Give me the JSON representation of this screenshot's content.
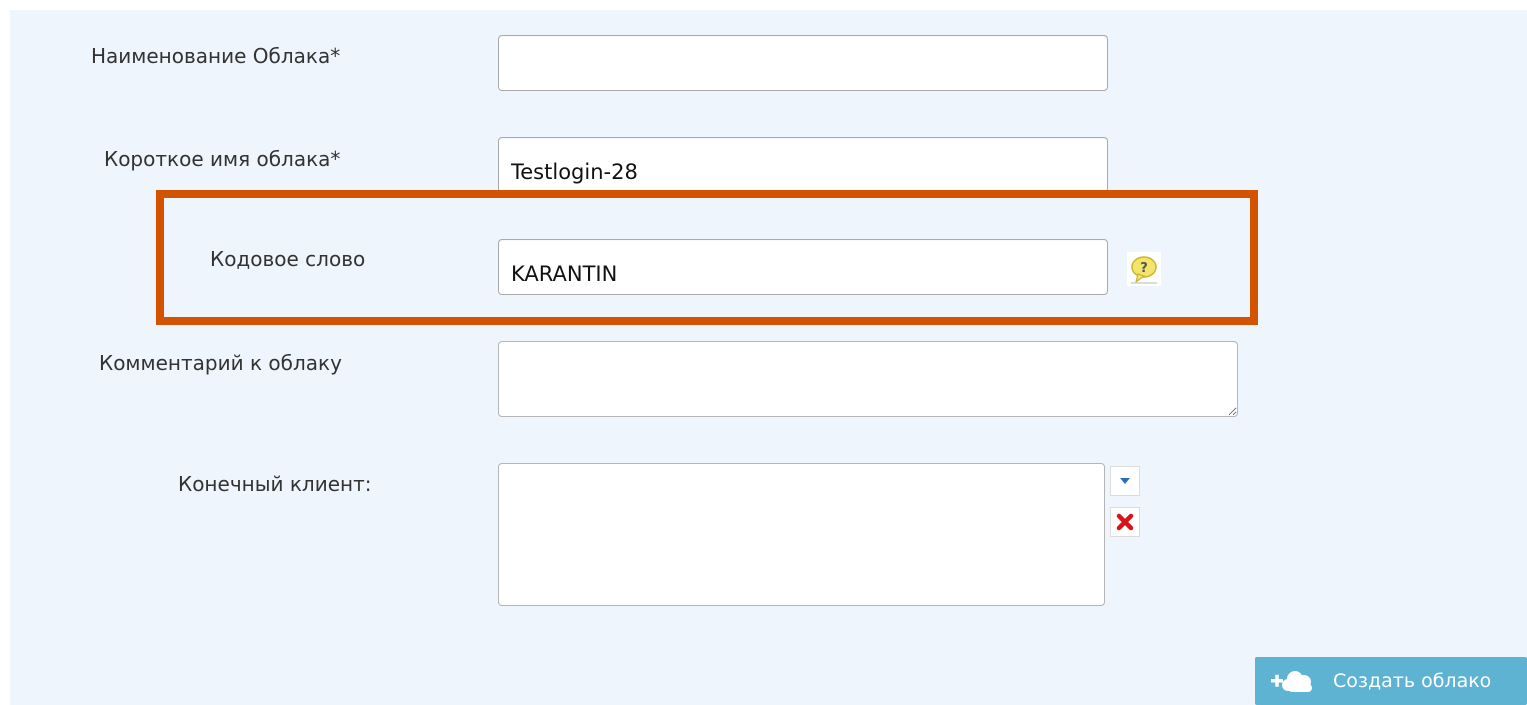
{
  "form": {
    "cloud_name": {
      "label": "Наименование Облака*",
      "value": ""
    },
    "cloud_short_name": {
      "label": "Короткое имя облака*",
      "value": "Testlogin-28"
    },
    "code_word": {
      "label": "Кодовое слово",
      "value": "KARANTIN",
      "help_icon": "help-speech-bubble-icon"
    },
    "cloud_comment": {
      "label": "Комментарий к облаку",
      "value": ""
    },
    "end_client": {
      "label": "Конечный клиент:",
      "dropdown_icon": "chevron-down-icon",
      "clear_icon": "red-x-clear-icon"
    }
  },
  "actions": {
    "create_cloud": {
      "label": "Создать облако",
      "icon": "add-cloud-icon"
    }
  },
  "colors": {
    "panel_background": "#eef5fd",
    "highlight_border": "#d35400",
    "create_button": "#5eb3d2",
    "help_icon": "#f3e46a"
  }
}
